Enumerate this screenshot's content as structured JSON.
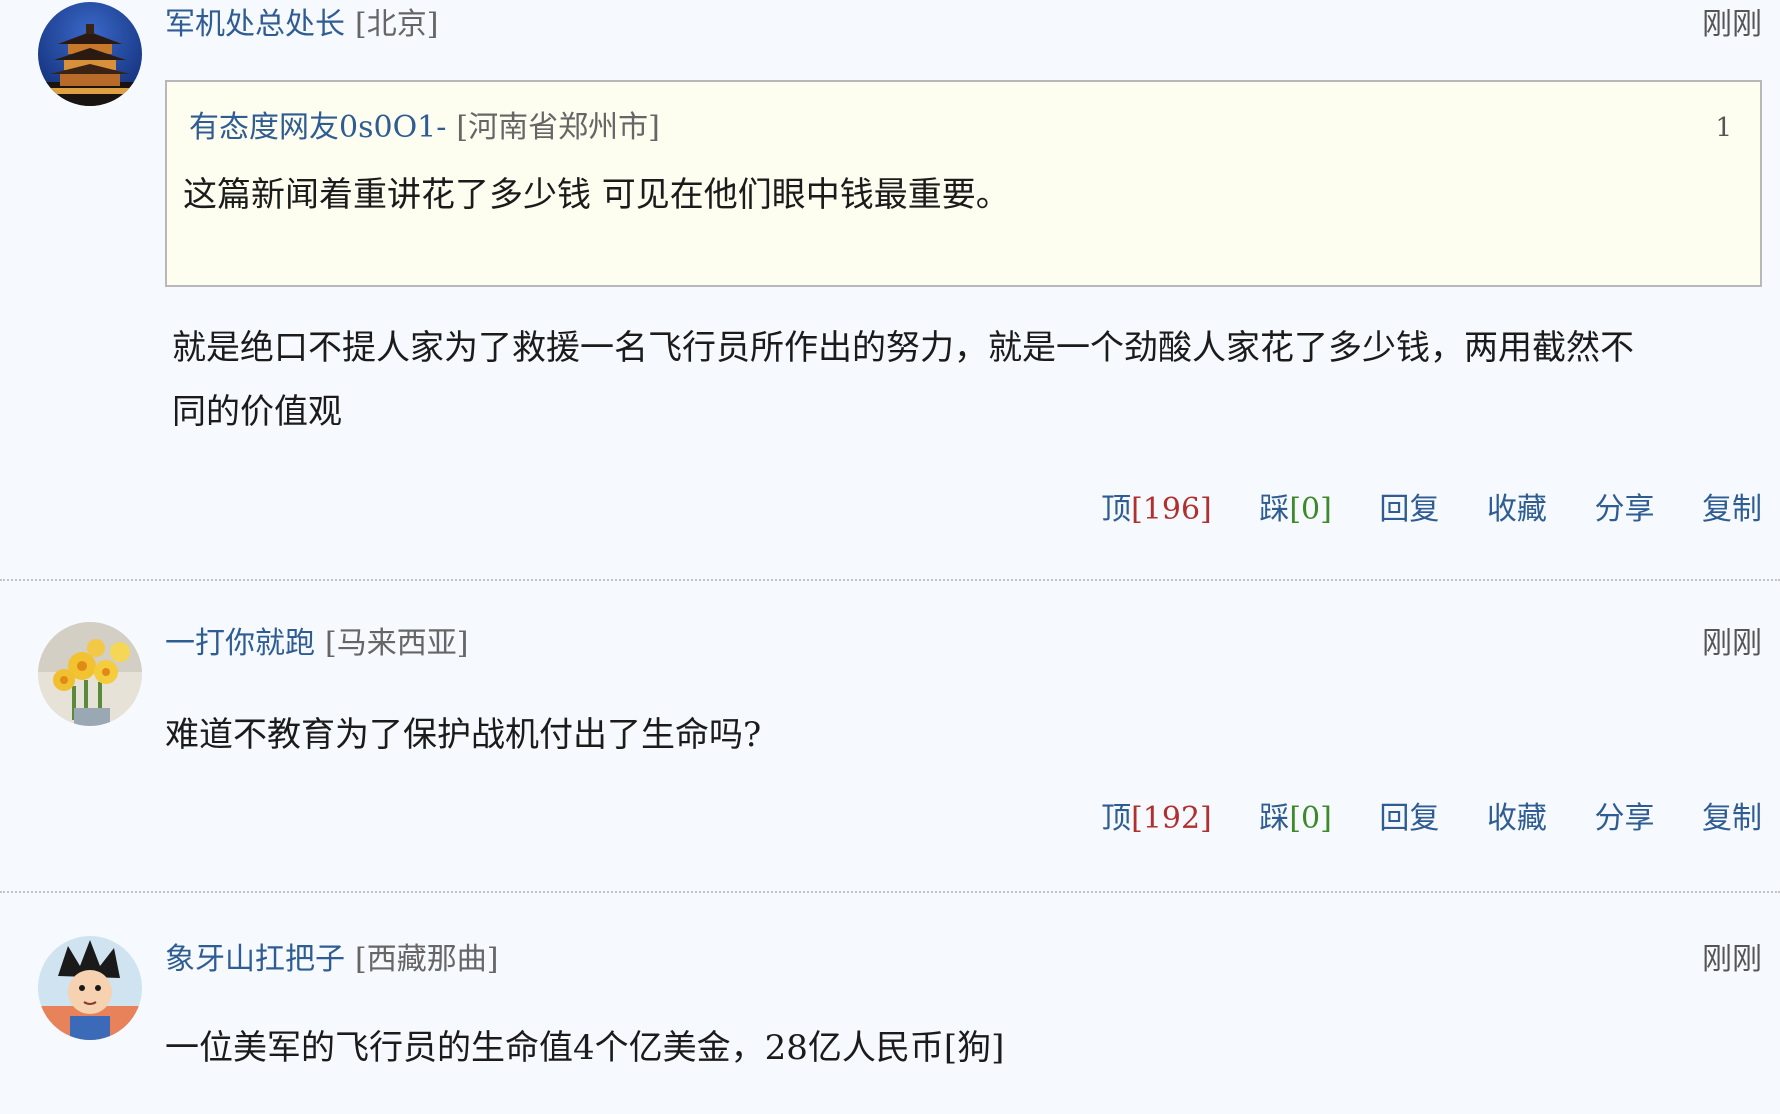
{
  "comments": [
    {
      "username": "军机处总处长",
      "location": "[北京]",
      "time": "刚刚",
      "avatar_icon": "night-tower-avatar",
      "quote": {
        "username": "有态度网友0s0O1-",
        "location": "[河南省郑州市]",
        "floor": "1",
        "text": "这篇新闻着重讲花了多少钱 可见在他们眼中钱最重要。"
      },
      "text_line1": "就是绝口不提人家为了救援一名飞行员所作出的努力，就是一个劲酸人家花了多少钱，两用截然不",
      "text_line2": "同的价值观",
      "actions": {
        "up_label": "顶",
        "up_count": "[196]",
        "down_label": "踩",
        "down_count": "[0]",
        "reply": "回复",
        "favorite": "收藏",
        "share": "分享",
        "copy": "复制"
      }
    },
    {
      "username": "一打你就跑",
      "location": "[马来西亚]",
      "time": "刚刚",
      "avatar_icon": "daffodil-avatar",
      "text": "难道不教育为了保护战机付出了生命吗?",
      "actions": {
        "up_label": "顶",
        "up_count": "[192]",
        "down_label": "踩",
        "down_count": "[0]",
        "reply": "回复",
        "favorite": "收藏",
        "share": "分享",
        "copy": "复制"
      }
    },
    {
      "username": "象牙山扛把子",
      "location": "[西藏那曲]",
      "time": "刚刚",
      "avatar_icon": "cartoon-boy-avatar",
      "text": "一位美军的飞行员的生命值4个亿美金，28亿人民币[狗]"
    }
  ],
  "colors": {
    "username": "#2f5d93",
    "up_count": "#b03030",
    "down_count": "#3d8a2a",
    "quote_bg": "#fdfdf0",
    "page_bg": "#f6f9fd"
  }
}
